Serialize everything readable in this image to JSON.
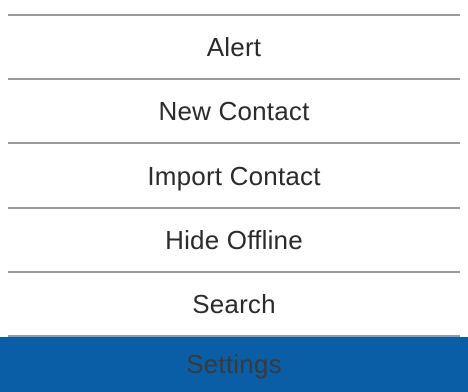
{
  "menu": {
    "items": [
      {
        "label": "Alert"
      },
      {
        "label": "New Contact"
      },
      {
        "label": "Import Contact"
      },
      {
        "label": "Hide Offline"
      },
      {
        "label": "Search"
      },
      {
        "label": "Settings",
        "selected": true
      }
    ]
  },
  "colors": {
    "selected_background": "#0a5ea5",
    "divider": "#9a9a9a",
    "text": "#2b2b2b"
  }
}
